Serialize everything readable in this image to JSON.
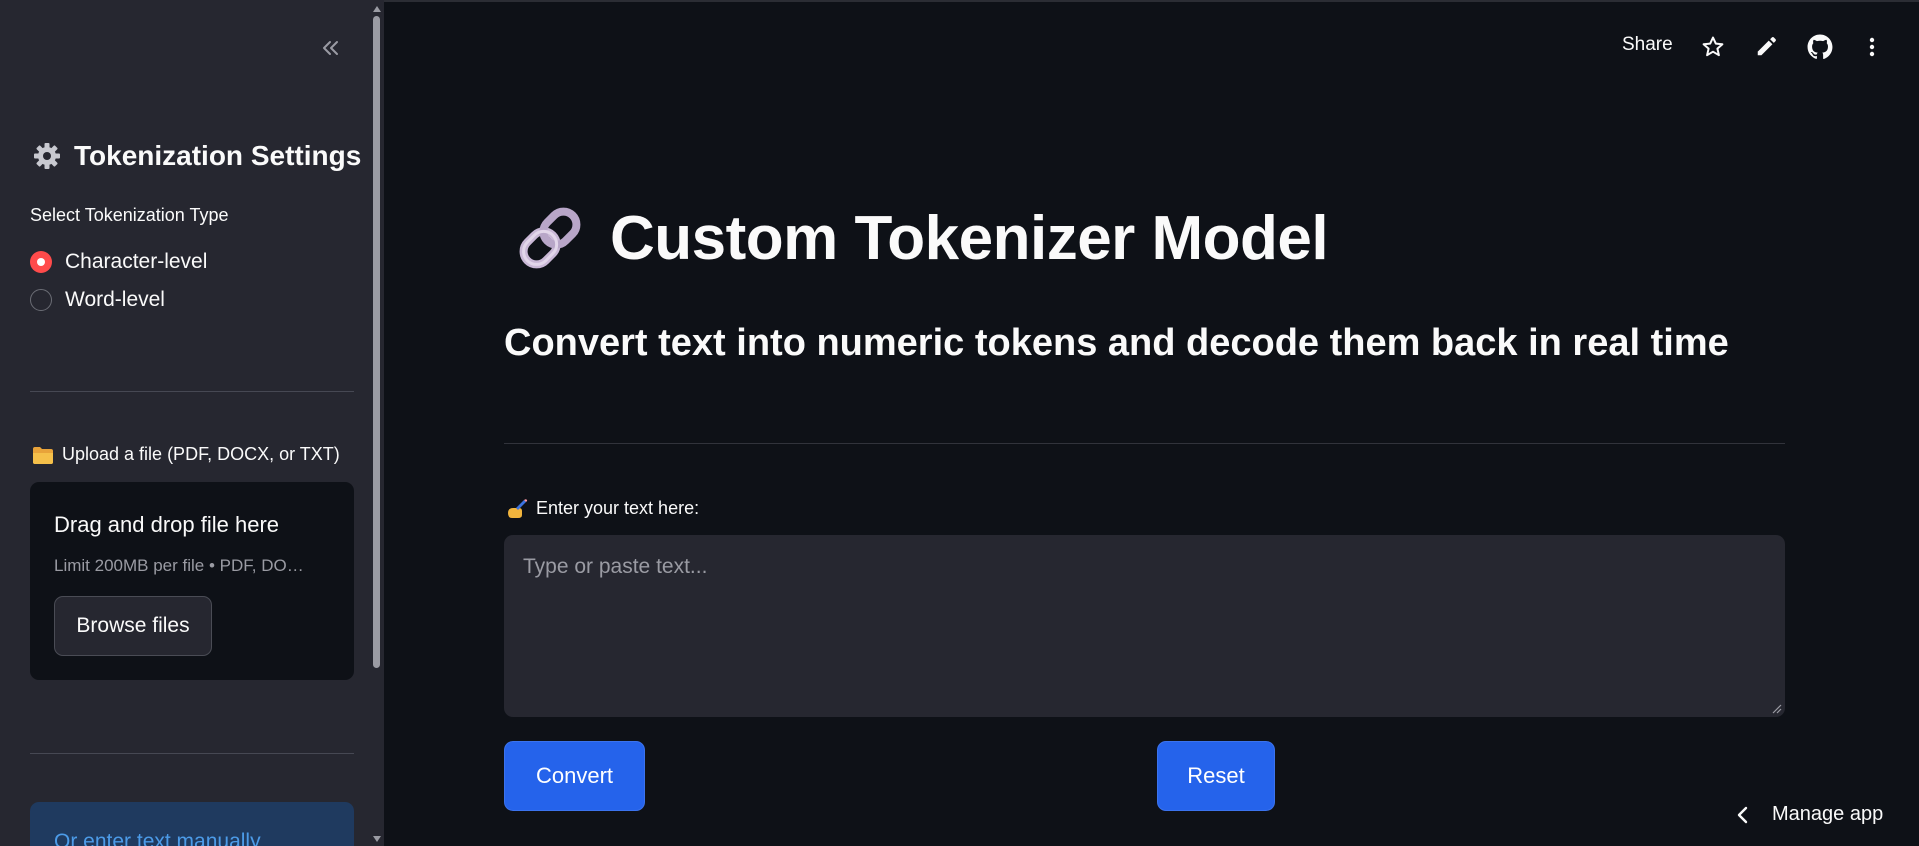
{
  "sidebar": {
    "heading": "Tokenization Settings",
    "heading_icon": "gear-icon",
    "select_label": "Select Tokenization Type",
    "options": [
      {
        "label": "Character-level",
        "selected": true
      },
      {
        "label": "Word-level",
        "selected": false
      }
    ],
    "upload": {
      "label": "Upload a file (PDF, DOCX, or TXT)",
      "label_icon": "folder-icon",
      "drop_title": "Drag and drop file here",
      "drop_subtitle": "Limit 200MB per file • PDF, DO…",
      "browse_label": "Browse files"
    },
    "manual_info": "Or enter text manually"
  },
  "header": {
    "share_label": "Share",
    "icons": [
      "star-icon",
      "edit-icon",
      "github-icon",
      "more-vertical-icon"
    ]
  },
  "main": {
    "title_icon": "link-icon",
    "title": "Custom Tokenizer Model",
    "subtitle": "Convert text into numeric tokens and decode them back in real time",
    "input_label": "Enter your text here:",
    "input_label_icon": "writing-hand-icon",
    "input_placeholder": "Type or paste text...",
    "input_value": "",
    "convert_label": "Convert",
    "reset_label": "Reset"
  },
  "footer": {
    "manage_app_label": "Manage app"
  },
  "colors": {
    "background": "#0e1117",
    "sidebar": "#262730",
    "primary": "#2563eb",
    "radio_accent": "#ff4b4b",
    "info_bg": "#1f3a5f",
    "info_text": "#4c9be8"
  }
}
